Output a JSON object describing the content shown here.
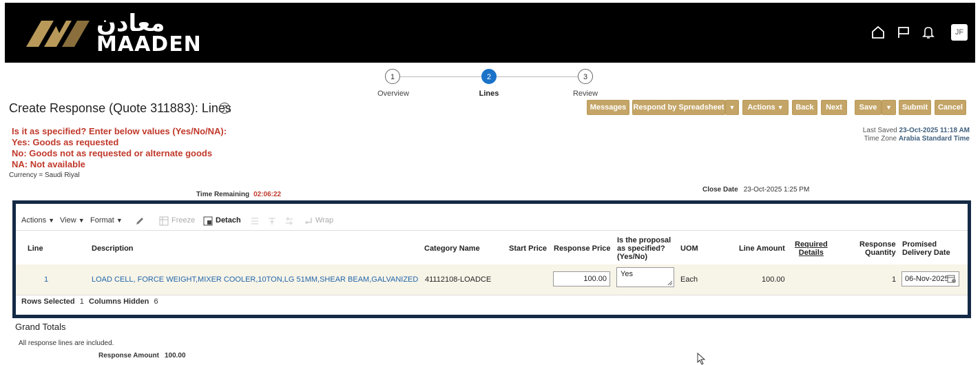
{
  "header": {
    "brand_arabic": "معادن",
    "brand_latin": "MAADEN",
    "icons": [
      "home-icon",
      "flag-icon",
      "bell-icon"
    ],
    "user_initials": "JF",
    "bg_color": "#000000",
    "logo_color": "#b8995a"
  },
  "train": {
    "stops": [
      {
        "number": "1",
        "label": "Overview",
        "active": false
      },
      {
        "number": "2",
        "label": "Lines",
        "active": true
      },
      {
        "number": "3",
        "label": "Review",
        "active": false
      }
    ],
    "active_color": "#1a73c8"
  },
  "page": {
    "title": "Create Response (Quote 311883): Lines",
    "help_glyph": "?"
  },
  "buttons": {
    "messages": "Messages",
    "respond_by_spreadsheet": "Respond by Spreadsheet",
    "actions": "Actions",
    "back": "Back",
    "next": "Next",
    "save": "Save",
    "submit": "Submit",
    "cancel": "Cancel",
    "color": "#c4a567"
  },
  "instructions": {
    "line1": "Is it as specified? Enter below values (Yes/No/NA):",
    "line2": "Yes: Goods as requested",
    "line3": "No: Goods not as requested or alternate goods",
    "line4": "NA: Not available",
    "color": "#c0392b"
  },
  "currency": "Currency = Saudi Riyal",
  "last_saved": {
    "label": "Last Saved",
    "value": "23-Oct-2025 11:18 AM",
    "tz_label": "Time Zone",
    "tz_value": "Arabia Standard Time"
  },
  "time_remaining": {
    "label": "Time Remaining",
    "value": "02:06:22"
  },
  "close_date": {
    "label": "Close Date",
    "value": "23-Oct-2025 1:25 PM"
  },
  "toolbar": {
    "actions": "Actions",
    "view": "View",
    "format": "Format",
    "freeze": "Freeze",
    "detach": "Detach",
    "wrap": "Wrap"
  },
  "table": {
    "columns": {
      "line": "Line",
      "description": "Description",
      "category": "Category Name",
      "start_price": "Start Price",
      "response_price": "Response Price",
      "as_specified_1": "Is the proposal",
      "as_specified_2": "as specified?",
      "as_specified_3": "(Yes/No)",
      "uom": "UOM",
      "line_amount": "Line Amount",
      "required_1": "Required",
      "required_2": "Details",
      "resp_qty_1": "Response",
      "resp_qty_2": "Quantity",
      "promised_1": "Promised",
      "promised_2": "Delivery Date"
    },
    "row": {
      "line": "1",
      "description": "LOAD CELL, FORCE WEIGHT,MIXER COOLER,10TON,LG 51MM,SHEAR BEAM,GALVANIZED STEEL,C",
      "category": "41112108-LOADCE",
      "start_price": "",
      "response_price": "100.00",
      "as_specified": "Yes",
      "uom": "Each",
      "line_amount": "100.00",
      "response_quantity": "1",
      "promised_date": "06-Nov-2025"
    },
    "status": {
      "rows_selected_label": "Rows Selected",
      "rows_selected_value": "1",
      "columns_hidden_label": "Columns Hidden",
      "columns_hidden_value": "6"
    },
    "border_color": "#142a45"
  },
  "grand_totals": {
    "title": "Grand Totals",
    "note": "All response lines are included.",
    "response_amount_label": "Response Amount",
    "response_amount_value": "100.00"
  }
}
